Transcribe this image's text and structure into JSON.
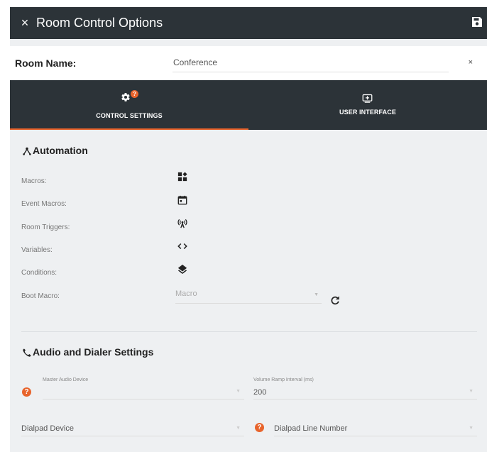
{
  "header": {
    "title": "Room Control Options",
    "close_glyph": "×"
  },
  "room_name": {
    "label": "Room Name:",
    "value": "Conference",
    "clear_glyph": "×"
  },
  "tabs": [
    {
      "label": "CONTROL SETTINGS",
      "icon": "gear-icon",
      "badge": "?",
      "active": true
    },
    {
      "label": "USER INTERFACE",
      "icon": "screen-share-icon",
      "active": false
    }
  ],
  "automation": {
    "title": "Automation",
    "icon": "hub-icon",
    "rows": [
      {
        "label": "Macros:",
        "icon": "widgets-icon"
      },
      {
        "label": "Event Macros:",
        "icon": "calendar-icon"
      },
      {
        "label": "Room Triggers:",
        "icon": "antenna-icon"
      },
      {
        "label": "Variables:",
        "icon": "code-icon"
      },
      {
        "label": "Conditions:",
        "icon": "layers-icon"
      }
    ],
    "boot_macro": {
      "label": "Boot Macro:",
      "placeholder": "Macro",
      "refresh_icon": "refresh-icon"
    }
  },
  "audio": {
    "title": "Audio and Dialer Settings",
    "icon": "phone-icon",
    "help_glyph": "?",
    "master_audio_device": {
      "label": "Master Audio Device",
      "value": ""
    },
    "volume_ramp_interval": {
      "label": "Volume Ramp Interval (ms)",
      "value": "200"
    },
    "dialpad_device": {
      "placeholder": "Dialpad Device"
    },
    "dialpad_line_number": {
      "placeholder": "Dialpad Line Number"
    }
  },
  "colors": {
    "header_bg": "#2c3338",
    "accent": "#e8642c",
    "panel_bg": "#eef0f2"
  }
}
